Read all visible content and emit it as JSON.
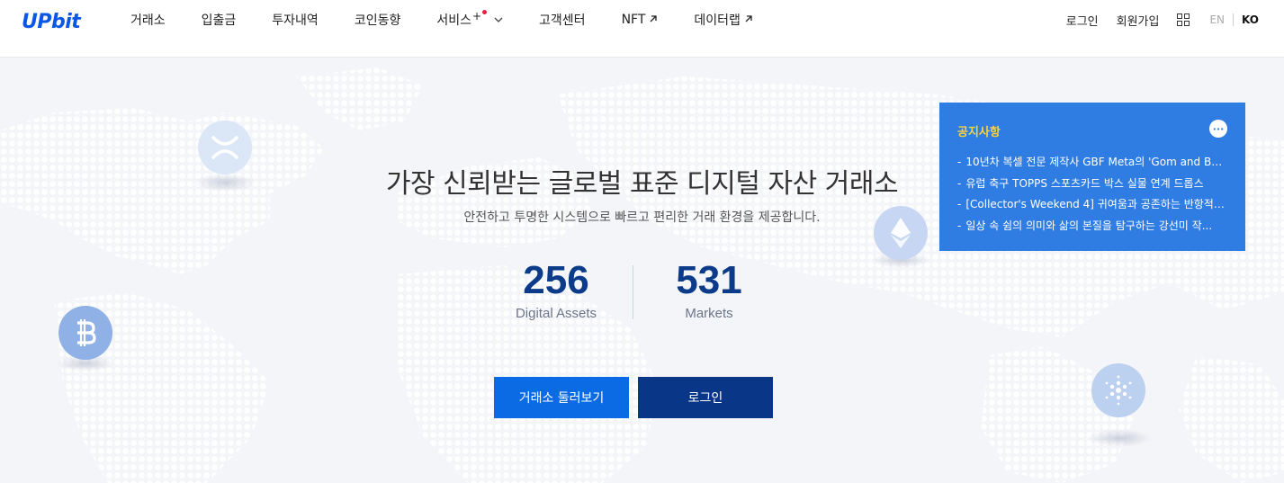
{
  "header": {
    "logo_text": "UPbit",
    "nav": [
      {
        "label": "거래소"
      },
      {
        "label": "입출금"
      },
      {
        "label": "투자내역"
      },
      {
        "label": "코인동향"
      },
      {
        "label": "서비스",
        "sup": "+"
      },
      {
        "label": "고객센터"
      },
      {
        "label": "NFT"
      },
      {
        "label": "데이터랩"
      }
    ],
    "login": "로그인",
    "signup": "회원가입",
    "lang_en": "EN",
    "lang_ko": "KO"
  },
  "hero": {
    "headline": "가장 신뢰받는 글로벌 표준 디지털 자산 거래소",
    "subline": "안전하고 투명한 시스템으로 빠르고 편리한 거래 환경을 제공합니다.",
    "stats": [
      {
        "value": "256",
        "label": "Digital Assets"
      },
      {
        "value": "531",
        "label": "Markets"
      }
    ],
    "btn_explore": "거래소 둘러보기",
    "btn_login": "로그인"
  },
  "notice": {
    "title": "공지사항",
    "more": "···",
    "items": [
      "10년차 복셀 전문 제작사 GBF Meta의 'Gom and Bu...",
      "유럽 축구 TOPPS 스포츠카드 박스 실물 연계 드롭스",
      "[Collector's Weekend 4] 귀여움과 공존하는 반항적 ...",
      "일상 속 쉼의 의미와 삶의 본질을 탐구하는 강선미 작..."
    ]
  },
  "colors": {
    "brand": "#0a57e6",
    "primary_button": "#0b6be4",
    "dark_button": "#093687",
    "notice_bg": "#2f7ce3",
    "notice_title": "#ffd338",
    "stat_number": "#0c3b8a"
  },
  "icons": [
    "grid-icon",
    "chevron-down-icon",
    "external-arrow-icon",
    "xrp-coin-icon",
    "ethereum-coin-icon",
    "bitcoin-coin-icon",
    "cardano-coin-icon",
    "more-icon"
  ]
}
